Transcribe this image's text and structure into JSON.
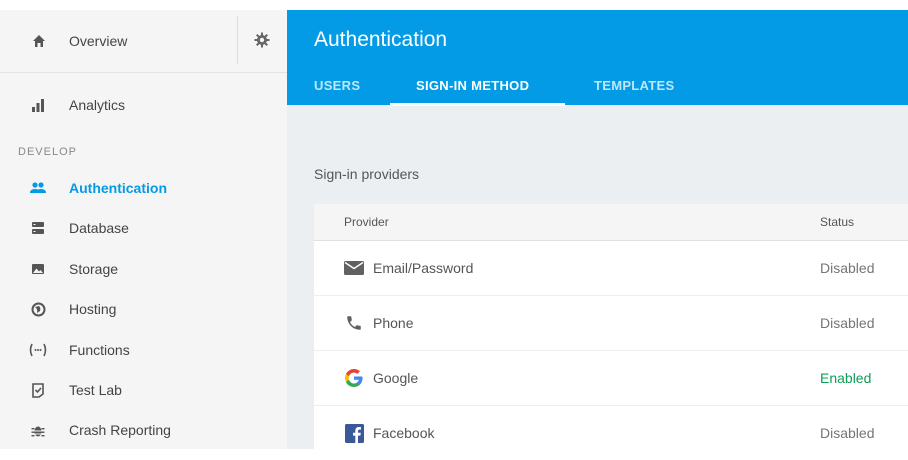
{
  "sidebar": {
    "overview_label": "Overview",
    "analytics_label": "Analytics",
    "section_label": "DEVELOP",
    "items": [
      {
        "label": "Authentication",
        "icon": "people-icon",
        "active": true
      },
      {
        "label": "Database",
        "icon": "database-icon",
        "active": false
      },
      {
        "label": "Storage",
        "icon": "image-icon",
        "active": false
      },
      {
        "label": "Hosting",
        "icon": "globe-icon",
        "active": false
      },
      {
        "label": "Functions",
        "icon": "functions-icon",
        "active": false
      },
      {
        "label": "Test Lab",
        "icon": "test-lab-icon",
        "active": false
      },
      {
        "label": "Crash Reporting",
        "icon": "bug-icon",
        "active": false
      }
    ]
  },
  "header": {
    "title": "Authentication",
    "tabs": [
      {
        "label": "USERS",
        "selected": false
      },
      {
        "label": "SIGN-IN METHOD",
        "selected": true
      },
      {
        "label": "TEMPLATES",
        "selected": false
      }
    ]
  },
  "providers": {
    "section_title": "Sign-in providers",
    "columns": {
      "provider": "Provider",
      "status": "Status"
    },
    "rows": [
      {
        "name": "Email/Password",
        "status": "Disabled",
        "icon": "email-icon"
      },
      {
        "name": "Phone",
        "status": "Disabled",
        "icon": "phone-icon"
      },
      {
        "name": "Google",
        "status": "Enabled",
        "icon": "google-icon"
      },
      {
        "name": "Facebook",
        "status": "Disabled",
        "icon": "facebook-icon"
      }
    ]
  },
  "colors": {
    "accent": "#039be5",
    "enabled": "#0f9d58",
    "sidebar_bg": "#f5f5f5",
    "content_bg": "#eceff1"
  }
}
